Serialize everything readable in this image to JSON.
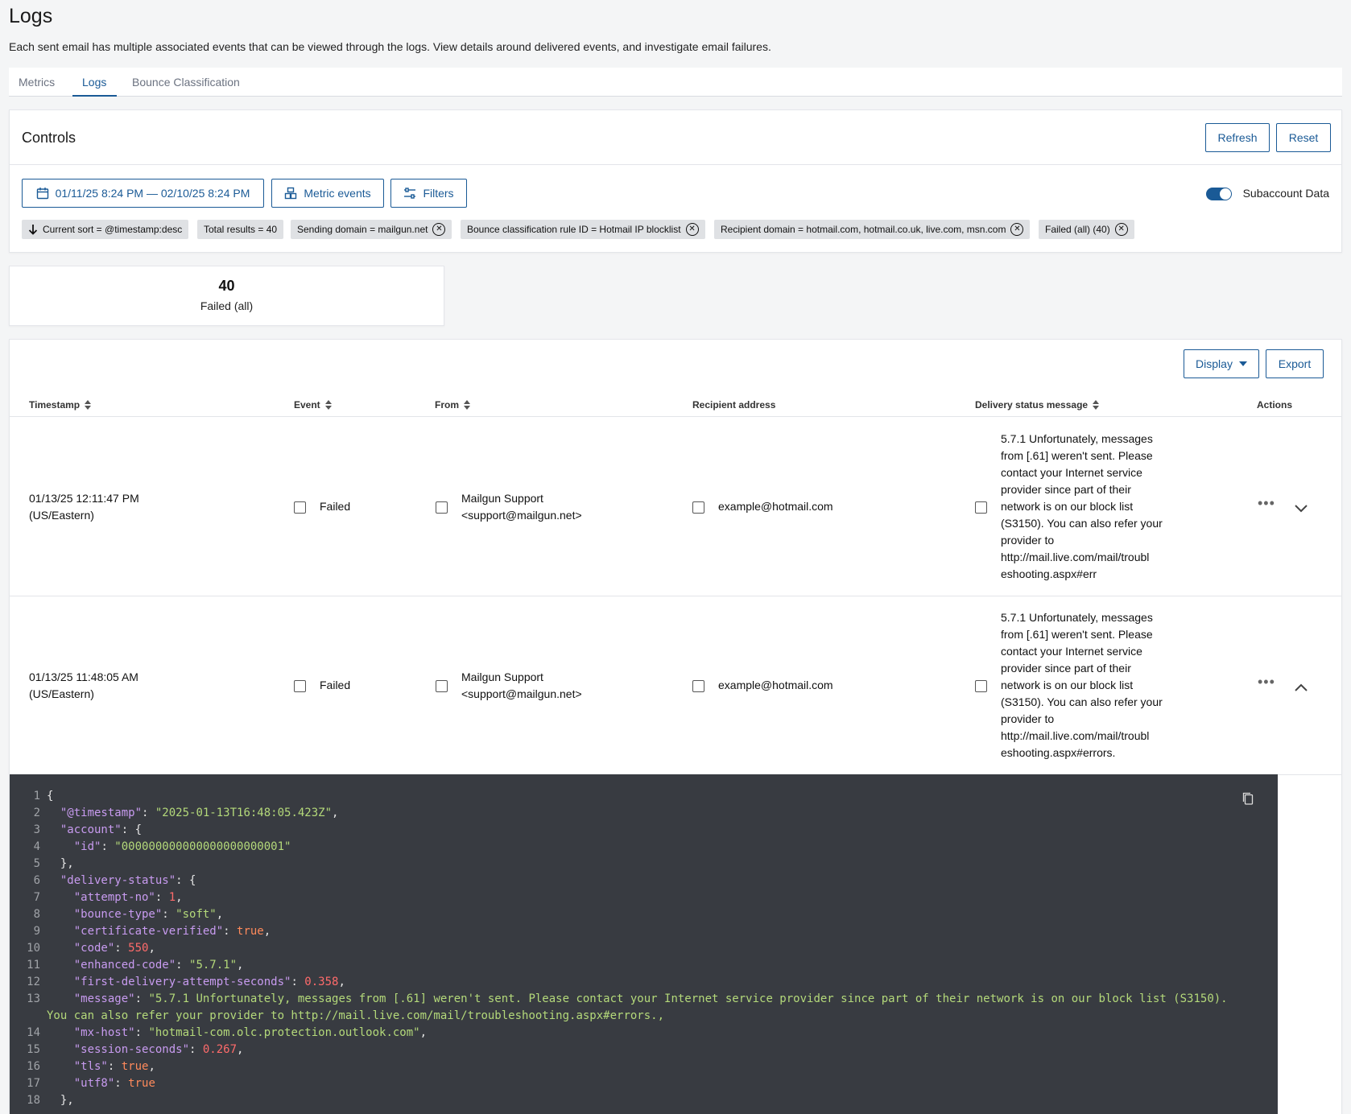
{
  "page": {
    "title": "Logs",
    "description": "Each sent email has multiple associated events that can be viewed through the logs. View details around delivered events, and investigate email failures."
  },
  "tabs": [
    {
      "label": "Metrics"
    },
    {
      "label": "Logs",
      "active": true
    },
    {
      "label": "Bounce Classification"
    }
  ],
  "controls": {
    "title": "Controls",
    "refresh_label": "Refresh",
    "reset_label": "Reset",
    "date_range": "01/11/25 8:24 PM — 02/10/25 8:24 PM",
    "metric_events_label": "Metric events",
    "filters_label": "Filters",
    "subaccount_label": "Subaccount Data",
    "subaccount_on": true,
    "chips": [
      {
        "text": "Current sort = @timestamp:desc"
      },
      {
        "text": "Total results = 40"
      },
      {
        "text": "Sending domain = mailgun.net"
      },
      {
        "text": "Bounce classification rule ID = Hotmail IP blocklist"
      },
      {
        "text": "Recipient domain = hotmail.com, hotmail.co.uk, live.com, msn.com"
      },
      {
        "text": "Failed (all) (40)"
      }
    ]
  },
  "stat": {
    "value": "40",
    "label": "Failed (all)"
  },
  "table": {
    "display_label": "Display",
    "export_label": "Export",
    "headers": {
      "timestamp": "Timestamp",
      "event": "Event",
      "from": "From",
      "recipient": "Recipient address",
      "delivery": "Delivery status message",
      "actions": "Actions"
    },
    "rows": [
      {
        "timestamp_1": "01/13/25 12:11:47 PM",
        "timestamp_2": "(US/Eastern)",
        "event": "Failed",
        "from_1": "Mailgun Support",
        "from_2": "<support@mailgun.net>",
        "recipient": "example@hotmail.com",
        "delivery": [
          "5.7.1 Unfortunately, messages",
          "from [.61] weren't sent. Please",
          "contact your Internet service",
          "provider since part of their",
          "network is on our block list",
          "(S3150). You can also refer your",
          "provider to",
          "http://mail.live.com/mail/troubl",
          "eshooting.aspx#err"
        ],
        "expanded": false
      },
      {
        "timestamp_1": "01/13/25 11:48:05 AM",
        "timestamp_2": "(US/Eastern)",
        "event": "Failed",
        "from_1": "Mailgun Support",
        "from_2": "<support@mailgun.net>",
        "recipient": "example@hotmail.com",
        "delivery": [
          "5.7.1 Unfortunately, messages",
          "from [.61] weren't sent. Please",
          "contact your Internet service",
          "provider since part of their",
          "network is on our block list",
          "(S3150). You can also refer your",
          "provider to",
          "http://mail.live.com/mail/troubl",
          "eshooting.aspx#errors."
        ],
        "expanded": true
      }
    ]
  },
  "code": {
    "lines": [
      {
        "n": "1",
        "t": [
          [
            "p",
            "{"
          ]
        ]
      },
      {
        "n": "2",
        "t": [
          [
            "p",
            "  "
          ],
          [
            "k",
            "\"@timestamp\""
          ],
          [
            "p",
            ": "
          ],
          [
            "s",
            "\"2025-01-13T16:48:05.423Z\""
          ],
          [
            "p",
            ","
          ]
        ]
      },
      {
        "n": "3",
        "t": [
          [
            "p",
            "  "
          ],
          [
            "k",
            "\"account\""
          ],
          [
            "p",
            ": {"
          ]
        ]
      },
      {
        "n": "4",
        "t": [
          [
            "p",
            "    "
          ],
          [
            "k",
            "\"id\""
          ],
          [
            "p",
            ": "
          ],
          [
            "s",
            "\"000000000000000000000001\""
          ]
        ]
      },
      {
        "n": "5",
        "t": [
          [
            "p",
            "  },"
          ]
        ]
      },
      {
        "n": "6",
        "t": [
          [
            "p",
            "  "
          ],
          [
            "k",
            "\"delivery-status\""
          ],
          [
            "p",
            ": {"
          ]
        ]
      },
      {
        "n": "7",
        "t": [
          [
            "p",
            "    "
          ],
          [
            "k",
            "\"attempt-no\""
          ],
          [
            "p",
            ": "
          ],
          [
            "n",
            "1"
          ],
          [
            "p",
            ","
          ]
        ]
      },
      {
        "n": "8",
        "t": [
          [
            "p",
            "    "
          ],
          [
            "k",
            "\"bounce-type\""
          ],
          [
            "p",
            ": "
          ],
          [
            "s",
            "\"soft\""
          ],
          [
            "p",
            ","
          ]
        ]
      },
      {
        "n": "9",
        "t": [
          [
            "p",
            "    "
          ],
          [
            "k",
            "\"certificate-verified\""
          ],
          [
            "p",
            ": "
          ],
          [
            "b",
            "true"
          ],
          [
            "p",
            ","
          ]
        ]
      },
      {
        "n": "10",
        "t": [
          [
            "p",
            "    "
          ],
          [
            "k",
            "\"code\""
          ],
          [
            "p",
            ": "
          ],
          [
            "n",
            "550"
          ],
          [
            "p",
            ","
          ]
        ]
      },
      {
        "n": "11",
        "t": [
          [
            "p",
            "    "
          ],
          [
            "k",
            "\"enhanced-code\""
          ],
          [
            "p",
            ": "
          ],
          [
            "s",
            "\"5.7.1\""
          ],
          [
            "p",
            ","
          ]
        ]
      },
      {
        "n": "12",
        "t": [
          [
            "p",
            "    "
          ],
          [
            "k",
            "\"first-delivery-attempt-seconds\""
          ],
          [
            "p",
            ": "
          ],
          [
            "n",
            "0.358"
          ],
          [
            "p",
            ","
          ]
        ]
      },
      {
        "n": "13",
        "t": [
          [
            "p",
            "    "
          ],
          [
            "k",
            "\"message\""
          ],
          [
            "p",
            ": "
          ],
          [
            "s",
            "\"5.7.1 Unfortunately, messages from [.61] weren't sent. Please contact your Internet service provider since part of their network is on our block list (S3150)."
          ]
        ]
      },
      {
        "n": "",
        "t": [
          [
            "s",
            "You can also refer your provider to http://mail.live.com/mail/troubleshooting.aspx#errors.,"
          ]
        ]
      },
      {
        "n": "14",
        "t": [
          [
            "p",
            "    "
          ],
          [
            "k",
            "\"mx-host\""
          ],
          [
            "p",
            ": "
          ],
          [
            "s",
            "\"hotmail-com.olc.protection.outlook.com\""
          ],
          [
            "p",
            ","
          ]
        ]
      },
      {
        "n": "15",
        "t": [
          [
            "p",
            "    "
          ],
          [
            "k",
            "\"session-seconds\""
          ],
          [
            "p",
            ": "
          ],
          [
            "n",
            "0.267"
          ],
          [
            "p",
            ","
          ]
        ]
      },
      {
        "n": "16",
        "t": [
          [
            "p",
            "    "
          ],
          [
            "k",
            "\"tls\""
          ],
          [
            "p",
            ": "
          ],
          [
            "b",
            "true"
          ],
          [
            "p",
            ","
          ]
        ]
      },
      {
        "n": "17",
        "t": [
          [
            "p",
            "    "
          ],
          [
            "k",
            "\"utf8\""
          ],
          [
            "p",
            ": "
          ],
          [
            "b",
            "true"
          ]
        ]
      },
      {
        "n": "18",
        "t": [
          [
            "p",
            "  },"
          ]
        ]
      }
    ]
  }
}
